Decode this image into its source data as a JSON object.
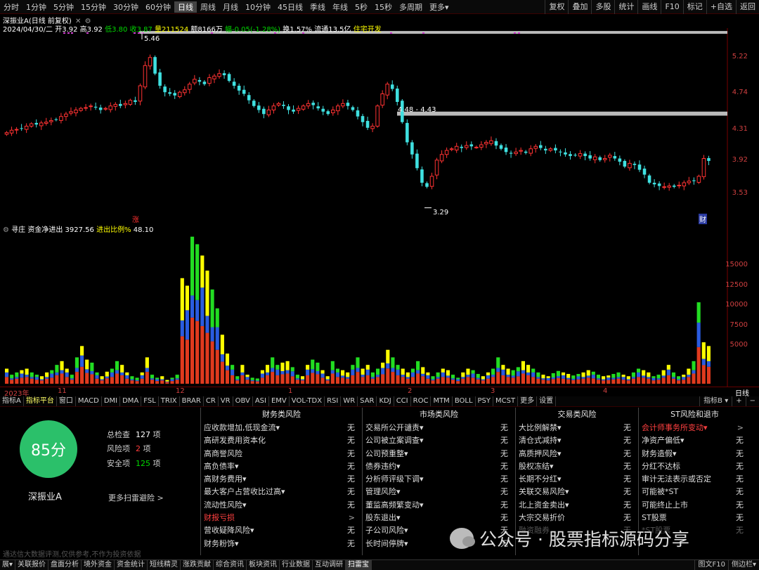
{
  "header": {
    "period_tabs": [
      "分时",
      "1分钟",
      "5分钟",
      "15分钟",
      "30分钟",
      "60分钟",
      "日线",
      "周线",
      "月线",
      "10分钟",
      "45日线",
      "季线",
      "年线",
      "5秒",
      "15秒",
      "多周期",
      "更多▾"
    ],
    "active_index": 6,
    "right_tools": [
      "复权",
      "叠加",
      "多股",
      "统计",
      "画线",
      "F10",
      "标记",
      "+自选",
      "返回"
    ]
  },
  "info": {
    "title": "深振业A(日线 前复权)",
    "date": "2024/04/30/二",
    "open_label": "开",
    "open": "3.92",
    "high_label": "高",
    "high": "3.92",
    "low_label": "低",
    "low": "3.80",
    "close_label": "收",
    "close": "3.87",
    "vol_label": "量",
    "vol": "211524",
    "amt_label": "额",
    "amt": "8166万",
    "amp_label": "幅",
    "amp": "-0.05(-1.28%)",
    "turn_label": "换",
    "turn": "1.57%",
    "float_label": "流通",
    "float": "13.5亿",
    "sector": "住宅开发"
  },
  "main_chart": {
    "price_axis": [
      "5.22",
      "4.74",
      "4.31",
      "3.92",
      "3.53"
    ],
    "high_label": "5.46",
    "low_label": "3.29",
    "zone_label": "4.48 - 4.43",
    "mark_zhang": "涨",
    "mark_cai": "财"
  },
  "volume_panel": {
    "indicator_name": "寻庄",
    "fund_label": "资金净进出",
    "fund_value": "3927.56",
    "ratio_label": "进出比例%",
    "ratio_value": "48.10",
    "axis": [
      "15000",
      "12500",
      "10000",
      "7500",
      "5000"
    ]
  },
  "date_axis": {
    "labels": [
      "2023年",
      "11",
      "12",
      "1",
      "2",
      "3",
      "4"
    ],
    "right": "日线"
  },
  "indicator_tabs": {
    "items": [
      "指标A",
      "指标平台",
      "窗口",
      "MACD",
      "DMI",
      "DMA",
      "FSL",
      "TRIX",
      "BRAR",
      "CR",
      "VR",
      "OBV",
      "ASI",
      "EMV",
      "VOL-TDX",
      "RSI",
      "WR",
      "SAR",
      "KDJ",
      "CCI",
      "ROC",
      "MTM",
      "BOLL",
      "PSY",
      "MCST",
      "更多",
      "设置"
    ],
    "active_index": 1,
    "right": [
      "指标B ▾",
      "+",
      "−"
    ]
  },
  "risk": {
    "score": "85分",
    "stock": "深振业A",
    "total_label": "总检查",
    "total": "127",
    "total_unit": "项",
    "risk_label": "风险项",
    "risk": "2",
    "risk_unit": "项",
    "safe_label": "安全项",
    "safe": "125",
    "safe_unit": "项",
    "more": "更多扫雷避险 >",
    "columns": [
      {
        "title": "财务类风险",
        "rows": [
          {
            "label": "应收款增加,低现金流▾",
            "val": "无"
          },
          {
            "label": "高研发费用资本化",
            "val": "无"
          },
          {
            "label": "高商誉风险",
            "val": "无"
          },
          {
            "label": "高负债率▾",
            "val": "无"
          },
          {
            "label": "高财务费用▾",
            "val": "无"
          },
          {
            "label": "最大客户占营收比过高▾",
            "val": "无"
          },
          {
            "label": "流动性风险▾",
            "val": "无"
          },
          {
            "label": "财报亏损",
            "val": ">",
            "warn": true
          },
          {
            "label": "营收疑降风险▾",
            "val": "无"
          },
          {
            "label": "财务粉饰▾",
            "val": "无"
          }
        ]
      },
      {
        "title": "市场类风险",
        "rows": [
          {
            "label": "交易所公开谴责▾",
            "val": "无"
          },
          {
            "label": "公司被立案调查▾",
            "val": "无"
          },
          {
            "label": "公司预重整▾",
            "val": "无"
          },
          {
            "label": "债券违约▾",
            "val": "无"
          },
          {
            "label": "分析师评级下调▾",
            "val": "无"
          },
          {
            "label": "管理风险▾",
            "val": "无"
          },
          {
            "label": "董监高频繁变动▾",
            "val": "无"
          },
          {
            "label": "股东退出▾",
            "val": "无"
          },
          {
            "label": "子公司风险▾",
            "val": "无"
          },
          {
            "label": "长时间停牌▾",
            "val": "无"
          }
        ]
      },
      {
        "title": "交易类风险",
        "rows": [
          {
            "label": "大比例解禁▾",
            "val": "无"
          },
          {
            "label": "清仓式减持▾",
            "val": "无"
          },
          {
            "label": "高质押风险▾",
            "val": "无"
          },
          {
            "label": "股权冻结▾",
            "val": "无"
          },
          {
            "label": "长期不分红▾",
            "val": "无"
          },
          {
            "label": "关联交易风险▾",
            "val": "无"
          },
          {
            "label": "北上资金卖出▾",
            "val": "无"
          },
          {
            "label": "大宗交易折价",
            "val": "无"
          },
          {
            "label": "融资融券…",
            "val": "无",
            "faded": true
          }
        ]
      },
      {
        "title": "ST风险和退市",
        "rows": [
          {
            "label": "会计师事务所变动▾",
            "val": ">",
            "warn": true
          },
          {
            "label": "净资产偏低▾",
            "val": "无"
          },
          {
            "label": "财务造假▾",
            "val": "无"
          },
          {
            "label": "分红不达标",
            "val": "无"
          },
          {
            "label": "审计无法表示或否定",
            "val": "无"
          },
          {
            "label": "可能被*ST",
            "val": "无"
          },
          {
            "label": "可能终止上市",
            "val": "无"
          },
          {
            "label": "ST股票",
            "val": "无"
          },
          {
            "label": "*ST股票",
            "val": "无",
            "faded": true
          }
        ]
      }
    ]
  },
  "disclaimer": "通达信大数据评测,仅供参考,不作为投资依据",
  "watermark": "公众号 · 股票指标源码分享",
  "footer": {
    "items": [
      "展▾",
      "关联报价",
      "盘面分析",
      "境外资金",
      "资金统计",
      "短线精灵",
      "涨跌贡献",
      "综合资讯",
      "板块资讯",
      "行业数据",
      "互动调研",
      "扫雷宝"
    ],
    "active_index": 11,
    "right": [
      "图文F10",
      "侧边栏▾"
    ]
  },
  "chart_data": [
    {
      "type": "candlestick",
      "title": "深振业A(日线 前复权)",
      "y_axis_ticks": [
        5.22,
        4.74,
        4.31,
        3.92,
        3.53
      ],
      "ylim": [
        3.2,
        5.6
      ],
      "annotated_high": 5.46,
      "annotated_low": 3.29,
      "zone": [
        4.48,
        4.43
      ],
      "close_path": [
        4.22,
        4.25,
        4.26,
        4.27,
        4.3,
        4.33,
        4.32,
        4.34,
        4.35,
        4.37,
        4.38,
        4.42,
        4.45,
        4.48,
        4.5,
        4.52,
        4.53,
        4.55,
        4.53,
        4.5,
        4.52,
        4.55,
        4.57,
        4.55,
        4.58,
        4.62,
        4.6,
        4.8,
        5.05,
        5.15,
        4.95,
        4.8,
        4.72,
        4.7,
        4.68,
        4.72,
        4.75,
        4.82,
        4.88,
        4.85,
        4.82,
        4.9,
        4.92,
        4.95,
        4.93,
        4.86,
        4.8,
        4.74,
        4.7,
        4.62,
        4.55,
        4.5,
        4.45,
        4.5,
        4.55,
        4.58,
        4.55,
        4.5,
        4.48,
        4.52,
        4.55,
        4.58,
        4.56,
        4.52,
        4.48,
        4.45,
        4.5,
        4.55,
        4.58,
        4.55,
        4.5,
        4.42,
        4.35,
        4.28,
        4.3,
        4.55,
        4.7,
        4.82,
        4.76,
        4.6,
        4.35,
        4.1,
        3.95,
        3.78,
        3.6,
        3.55,
        3.68,
        3.88,
        3.95,
        4.0,
        4.02,
        4.05,
        4.03,
        4.06,
        4.05,
        4.04,
        4.07,
        4.1,
        4.12,
        4.06,
        4.02,
        3.98,
        3.96,
        3.98,
        4.0,
        3.97,
        4.02,
        4.05,
        4.03,
        4.0,
        4.02,
        4.0,
        3.98,
        3.95,
        3.93,
        3.94,
        3.96,
        3.93,
        3.9,
        3.92,
        3.88,
        3.9,
        3.94,
        3.9,
        3.86,
        3.8,
        3.84,
        3.82,
        3.76,
        3.7,
        3.6,
        3.58,
        3.56,
        3.55,
        3.56,
        3.55,
        3.57,
        3.6,
        3.62,
        3.62,
        3.68,
        3.9,
        3.87
      ]
    },
    {
      "type": "bar",
      "title": "寻庄 资金净进出",
      "y_axis_ticks": [
        15000,
        12500,
        10000,
        7500,
        5000
      ],
      "ylim": [
        0,
        20500
      ],
      "values": [
        2000,
        1200,
        1500,
        1800,
        2000,
        1500,
        1200,
        1000,
        1500,
        1800,
        2500,
        3000,
        2000,
        1200,
        3500,
        5000,
        3200,
        2800,
        1500,
        1000,
        1600,
        2000,
        3000,
        2500,
        1500,
        1000,
        800,
        1500,
        3500,
        1200,
        800,
        1000,
        500,
        800,
        1200,
        14000,
        13000,
        19500,
        18500,
        17000,
        15000,
        12500,
        10000,
        6500,
        4000,
        2500,
        1000,
        2500,
        1200,
        800,
        700,
        1800,
        2500,
        3500,
        2500,
        2800,
        3000,
        2200,
        1200,
        1000,
        2500,
        3200,
        2800,
        1800,
        1000,
        3000,
        2000,
        1800,
        1500,
        2500,
        3500,
        2000,
        2500,
        1500,
        2000,
        2800,
        4500,
        3500,
        2500,
        2000,
        1500,
        2000,
        3000,
        2200,
        1500,
        1000,
        1500,
        2000,
        1800,
        1200,
        800,
        1500,
        2000,
        1800,
        1300,
        1000,
        1500,
        2000,
        3500,
        2500,
        2000,
        1800,
        2200,
        3000,
        2500,
        2000,
        1500,
        1200,
        1000,
        1400,
        1700,
        1500,
        1300,
        1100,
        1300,
        1500,
        1800,
        1600,
        1200,
        1000,
        1100,
        1300,
        1500,
        1200,
        1000,
        1500,
        2000,
        1800,
        1500,
        1000,
        1200,
        1800,
        2500,
        1500,
        1000,
        1200,
        2000,
        3000,
        10800,
        5500,
        5000
      ]
    }
  ]
}
